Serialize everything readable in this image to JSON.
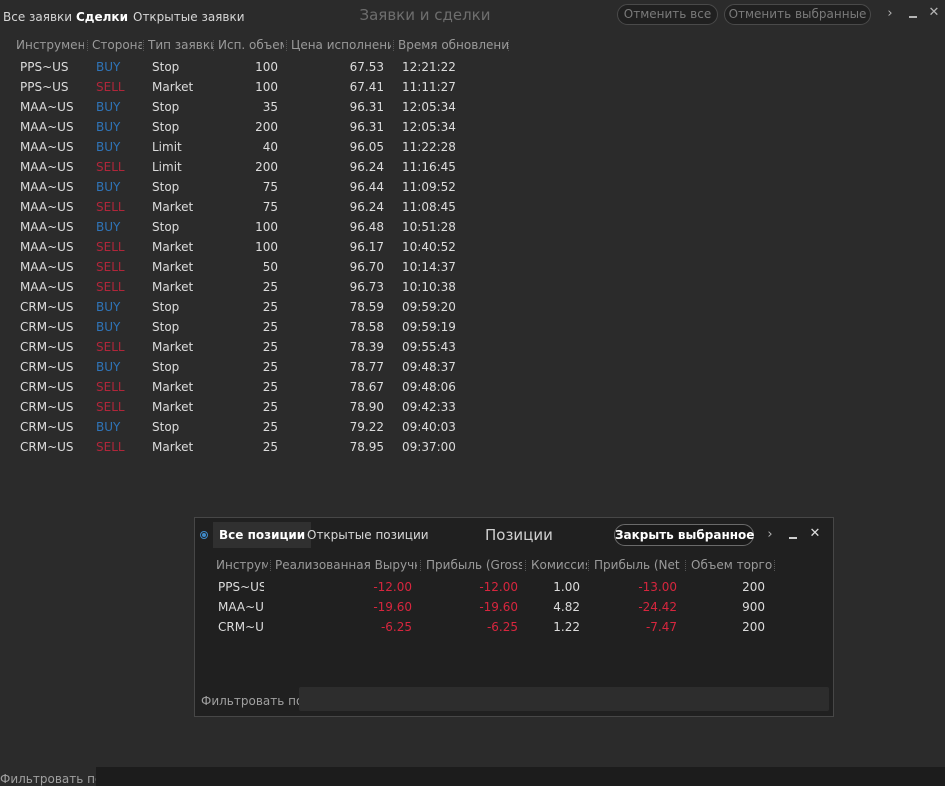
{
  "top_tabs": [
    "Все заявки",
    "Сделки",
    "Открытые заявки"
  ],
  "window_title": "Заявки и сделки",
  "buttons": {
    "cancel_all": "Отменить все",
    "cancel_selected": "Отменить выбранные"
  },
  "columns": [
    "Инструмент",
    "Сторона",
    "Тип заявки",
    "Исп. объем",
    "Цена исполнения",
    "Время обновления"
  ],
  "colors": {
    "buy": "#2f74b8",
    "sell": "#b0263a",
    "loss": "#d7263e"
  },
  "trades": [
    [
      "PPS~US",
      "BUY",
      "Stop",
      "100",
      "67.53",
      "12:21:22"
    ],
    [
      "PPS~US",
      "SELL",
      "Market",
      "100",
      "67.41",
      "11:11:27"
    ],
    [
      "MAA~US",
      "BUY",
      "Stop",
      "35",
      "96.31",
      "12:05:34"
    ],
    [
      "MAA~US",
      "BUY",
      "Stop",
      "200",
      "96.31",
      "12:05:34"
    ],
    [
      "MAA~US",
      "BUY",
      "Limit",
      "40",
      "96.05",
      "11:22:28"
    ],
    [
      "MAA~US",
      "SELL",
      "Limit",
      "200",
      "96.24",
      "11:16:45"
    ],
    [
      "MAA~US",
      "BUY",
      "Stop",
      "75",
      "96.44",
      "11:09:52"
    ],
    [
      "MAA~US",
      "SELL",
      "Market",
      "75",
      "96.24",
      "11:08:45"
    ],
    [
      "MAA~US",
      "BUY",
      "Stop",
      "100",
      "96.48",
      "10:51:28"
    ],
    [
      "MAA~US",
      "SELL",
      "Market",
      "100",
      "96.17",
      "10:40:52"
    ],
    [
      "MAA~US",
      "SELL",
      "Market",
      "50",
      "96.70",
      "10:14:37"
    ],
    [
      "MAA~US",
      "SELL",
      "Market",
      "25",
      "96.73",
      "10:10:38"
    ],
    [
      "CRM~US",
      "BUY",
      "Stop",
      "25",
      "78.59",
      "09:59:20"
    ],
    [
      "CRM~US",
      "BUY",
      "Stop",
      "25",
      "78.58",
      "09:59:19"
    ],
    [
      "CRM~US",
      "SELL",
      "Market",
      "25",
      "78.39",
      "09:55:43"
    ],
    [
      "CRM~US",
      "BUY",
      "Stop",
      "25",
      "78.77",
      "09:48:37"
    ],
    [
      "CRM~US",
      "SELL",
      "Market",
      "25",
      "78.67",
      "09:48:06"
    ],
    [
      "CRM~US",
      "SELL",
      "Market",
      "25",
      "78.90",
      "09:42:33"
    ],
    [
      "CRM~US",
      "BUY",
      "Stop",
      "25",
      "79.22",
      "09:40:03"
    ],
    [
      "CRM~US",
      "SELL",
      "Market",
      "25",
      "78.95",
      "09:37:00"
    ]
  ],
  "footer": {
    "filter_label": "Фильтровать по",
    "filter_value": ""
  },
  "positions": {
    "tabs": [
      "Все позиции",
      "Открытые позиции"
    ],
    "title": "Позиции",
    "close_selected": "Закрыть выбранное",
    "columns": [
      "Инструмент",
      "Реализованная Выручка",
      "Прибыль (Gross)",
      "Комиссия",
      "Прибыль (Net)",
      "Объем торгов"
    ],
    "rows": [
      [
        "PPS~US",
        "-12.00",
        "-12.00",
        "1.00",
        "-13.00",
        "200"
      ],
      [
        "MAA~US",
        "-19.60",
        "-19.60",
        "4.82",
        "-24.42",
        "900"
      ],
      [
        "CRM~US",
        "-6.25",
        "-6.25",
        "1.22",
        "-7.47",
        "200"
      ]
    ],
    "filter_label": "Фильтровать по",
    "filter_value": ""
  }
}
